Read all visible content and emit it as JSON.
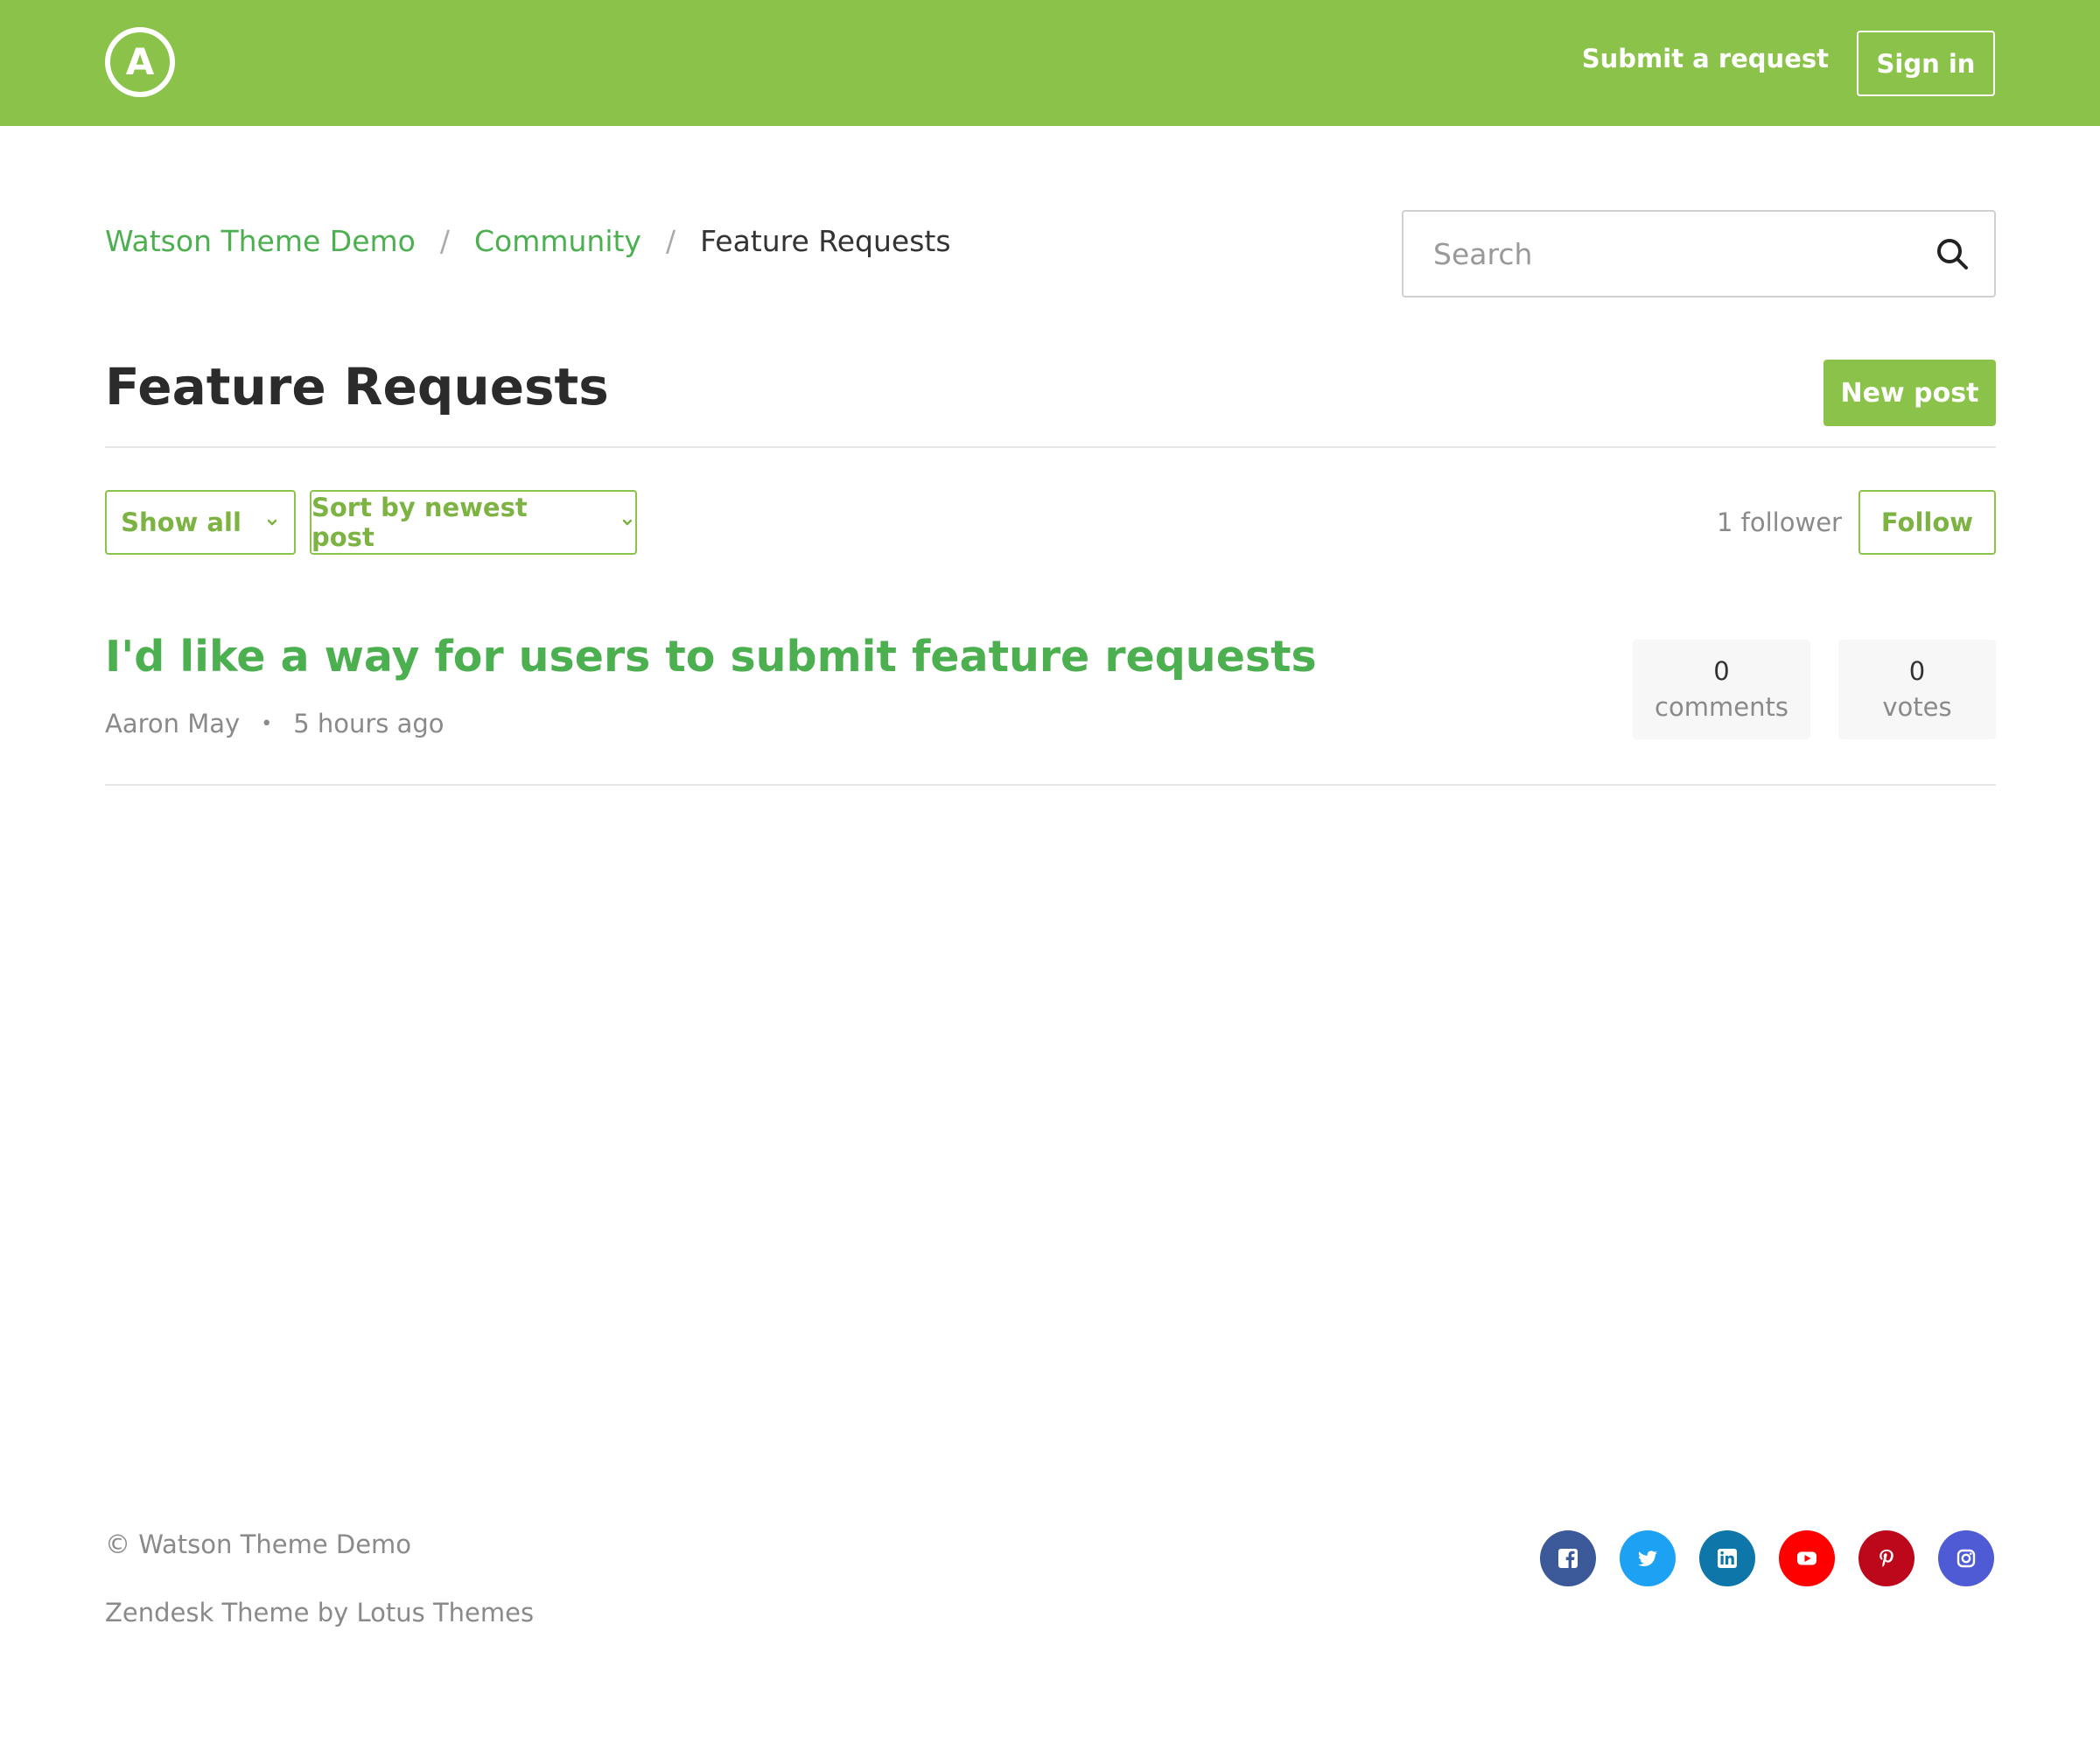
{
  "header": {
    "logo_letter": "A",
    "submit_request_label": "Submit a request",
    "sign_in_label": "Sign in",
    "brand_color": "#8bc34a"
  },
  "breadcrumb": {
    "items": [
      "Watson Theme Demo",
      "Community",
      "Feature Requests"
    ],
    "separator": "/"
  },
  "search": {
    "placeholder": "Search",
    "value": ""
  },
  "page": {
    "title": "Feature Requests",
    "new_post_label": "New post"
  },
  "filters": {
    "show_label": "Show all",
    "sort_label": "Sort by newest post",
    "follower_count": "1 follower",
    "follow_label": "Follow"
  },
  "posts": [
    {
      "title": "I'd like a way for users to submit feature requests",
      "author": "Aaron May",
      "time": "5 hours ago",
      "comments_count": "0",
      "comments_label": "comments",
      "votes_count": "0",
      "votes_label": "votes"
    }
  ],
  "footer": {
    "copyright": "© Watson Theme Demo",
    "credit": "Zendesk Theme by Lotus Themes",
    "social": [
      {
        "name": "facebook-icon",
        "color": "#3b5998"
      },
      {
        "name": "twitter-icon",
        "color": "#1da1f2"
      },
      {
        "name": "linkedin-icon",
        "color": "#0e76a8"
      },
      {
        "name": "youtube-icon",
        "color": "#ff0000"
      },
      {
        "name": "pinterest-icon",
        "color": "#bd081c"
      },
      {
        "name": "instagram-icon",
        "color": "#4f5bd5"
      }
    ]
  }
}
